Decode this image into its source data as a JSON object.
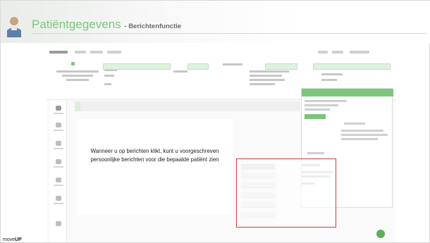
{
  "slide": {
    "title": "Patiëntgegevens",
    "subtitle": "- Berichtenfunctie",
    "callout_text": "Wanneer u op berichten klikt, kunt u voorgeschreven persoonlijke berichten voor die bepaalde patiënt zien",
    "footer_logo_prefix": "move",
    "footer_logo_suffix": "UP"
  },
  "colors": {
    "accent_green": "#7bc67a",
    "highlight_red": "#d23b3b",
    "title_text": "#7bc67a"
  },
  "icons": [
    "avatar-icon",
    "rail-icons",
    "fab-icon"
  ]
}
